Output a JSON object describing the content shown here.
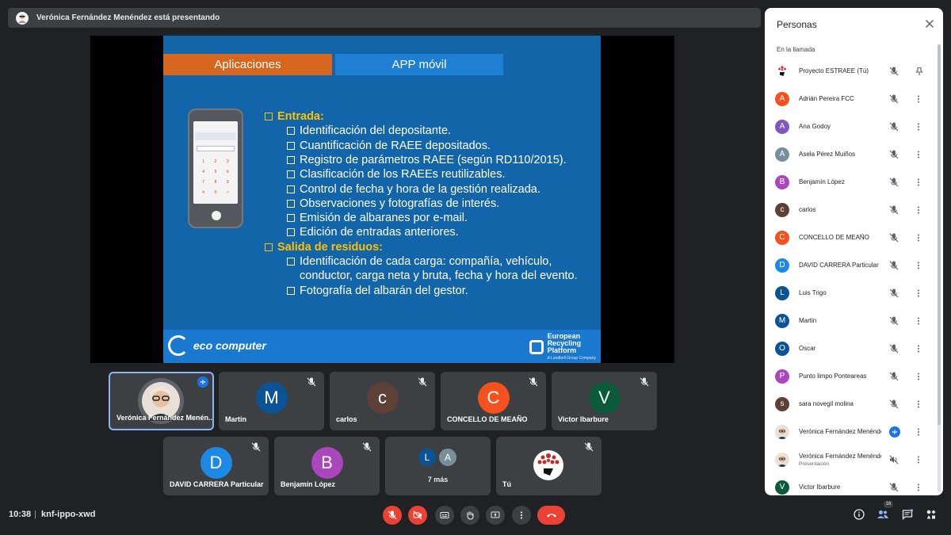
{
  "presenting_banner": "Verónica Fernández Menéndez está presentando",
  "slide": {
    "tab_left": "Aplicaciones",
    "tab_right": "APP móvil",
    "lines": [
      {
        "kind": "h",
        "text": "Entrada:"
      },
      {
        "kind": "sub",
        "text": "Identificación del depositante."
      },
      {
        "kind": "sub",
        "text": "Cuantificación de RAEE depositados."
      },
      {
        "kind": "sub",
        "text": "Registro de parámetros RAEE (según RD110/2015)."
      },
      {
        "kind": "sub",
        "text": "Clasificación de los RAEEs reutilizables."
      },
      {
        "kind": "sub",
        "text": "Control de fecha y hora de la gestión realizada."
      },
      {
        "kind": "sub",
        "text": "Observaciones y fotografías de interés."
      },
      {
        "kind": "sub",
        "text": "Emisión de albaranes por e-mail."
      },
      {
        "kind": "sub",
        "text": "Edición de entradas anteriores."
      },
      {
        "kind": "h",
        "text": "Salida de residuos:"
      },
      {
        "kind": "sub",
        "text": "Identificación de cada carga: compañía, vehículo,"
      },
      {
        "kind": "cont",
        "text": "conductor, carga neta y bruta, fecha y hora del evento."
      },
      {
        "kind": "sub",
        "text": "Fotografía del albarán del gestor."
      }
    ],
    "footer_left": "eco computer",
    "footer_right_line1": "European",
    "footer_right_line2": "Recycling",
    "footer_right_line3": "Platform",
    "footer_right_sub": "A Landbell Group Company"
  },
  "tiles": [
    {
      "name": "Verónica Fernández Menén...",
      "initial": "",
      "color": "",
      "type": "photo",
      "speaking": true
    },
    {
      "name": "Martin",
      "initial": "M",
      "color": "#0b5394"
    },
    {
      "name": "carlos",
      "initial": "c",
      "color": "#5d4037"
    },
    {
      "name": "CONCELLO DE MEAÑO",
      "initial": "C",
      "color": "#f4511e"
    },
    {
      "name": "Victor Ibarburе",
      "initial": "V",
      "color": "#0b5a3a"
    },
    {
      "name": "DAVID CARRERA Particular",
      "initial": "D",
      "color": "#1e88e5"
    },
    {
      "name": "Benjamín López",
      "initial": "B",
      "color": "#ab47bc"
    },
    {
      "name": "7 más",
      "type": "more",
      "initials": [
        "L",
        "A"
      ],
      "colors": [
        "#0b5394",
        "#78909c"
      ]
    },
    {
      "name": "Tú",
      "type": "self"
    }
  ],
  "bottom": {
    "time": "10:38",
    "separator": "|",
    "meeting_code": "knf-ippo-xwd",
    "participants_count": "16"
  },
  "panel": {
    "title": "Personas",
    "section": "En la llamada",
    "people": [
      {
        "name": "Proyecto ESTRAEE (Tú)",
        "initial": "",
        "color": "#ffffff",
        "kind": "self"
      },
      {
        "name": "Adrián Pereira FCC",
        "initial": "A",
        "color": "#f4511e"
      },
      {
        "name": "Ana Godoy",
        "initial": "A",
        "color": "#7e57c2"
      },
      {
        "name": "Asela Pérez Muiños",
        "initial": "A",
        "color": "#78909c"
      },
      {
        "name": "Benjamín López",
        "initial": "B",
        "color": "#ab47bc"
      },
      {
        "name": "carlos",
        "initial": "c",
        "color": "#5d4037"
      },
      {
        "name": "CONCELLO DE MEAÑO",
        "initial": "C",
        "color": "#f4511e"
      },
      {
        "name": "DAVID CARRERA Particular",
        "initial": "D",
        "color": "#1e88e5"
      },
      {
        "name": "Luis Trigo",
        "initial": "L",
        "color": "#0b5394"
      },
      {
        "name": "Martin",
        "initial": "M",
        "color": "#0b5394"
      },
      {
        "name": "Oscar",
        "initial": "O",
        "color": "#0b5394"
      },
      {
        "name": "Punto limpo Ponteareas",
        "initial": "P",
        "color": "#ab47bc"
      },
      {
        "name": "sara novegil molina",
        "initial": "s",
        "color": "#5d4037"
      },
      {
        "name": "Verónica Fernández Menéndez",
        "initial": "",
        "color": "#f1f3f4",
        "kind": "photo",
        "active": true
      },
      {
        "name": "Verónica Fernández Menéndez",
        "sub": "Presentación",
        "initial": "",
        "color": "#f1f3f4",
        "kind": "photo",
        "presenting": true
      },
      {
        "name": "Victor Ibarburе",
        "initial": "V",
        "color": "#0b5a3a"
      }
    ]
  }
}
